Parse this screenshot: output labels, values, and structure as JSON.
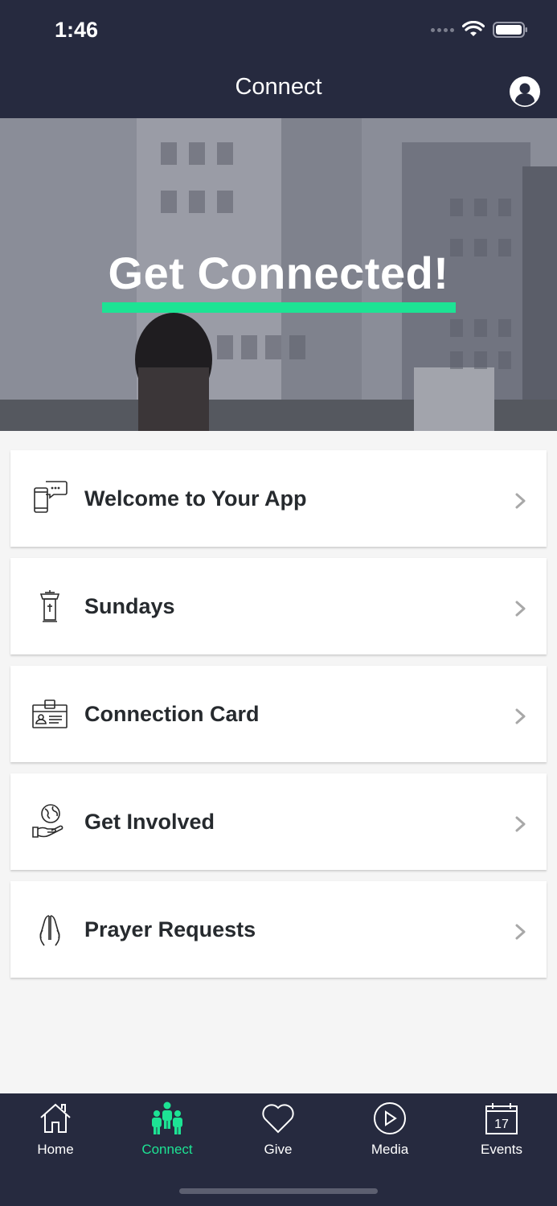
{
  "status": {
    "time": "1:46"
  },
  "header": {
    "title": "Connect"
  },
  "hero": {
    "title": "Get Connected!",
    "accent_color": "#1de394"
  },
  "list": {
    "items": [
      {
        "label": "Welcome to Your App",
        "icon": "phone-chat-icon"
      },
      {
        "label": "Sundays",
        "icon": "pulpit-icon"
      },
      {
        "label": "Connection Card",
        "icon": "id-card-icon"
      },
      {
        "label": "Get Involved",
        "icon": "globe-hand-icon"
      },
      {
        "label": "Prayer Requests",
        "icon": "praying-hands-icon"
      }
    ]
  },
  "tabbar": {
    "items": [
      {
        "label": "Home",
        "icon": "home-icon"
      },
      {
        "label": "Connect",
        "icon": "people-icon",
        "active": true
      },
      {
        "label": "Give",
        "icon": "heart-icon"
      },
      {
        "label": "Media",
        "icon": "play-circle-icon"
      },
      {
        "label": "Events",
        "icon": "calendar-icon"
      }
    ],
    "calendar_day": "17"
  },
  "colors": {
    "header_bg": "#262a3f",
    "accent": "#1de394",
    "background": "#f5f5f5"
  }
}
